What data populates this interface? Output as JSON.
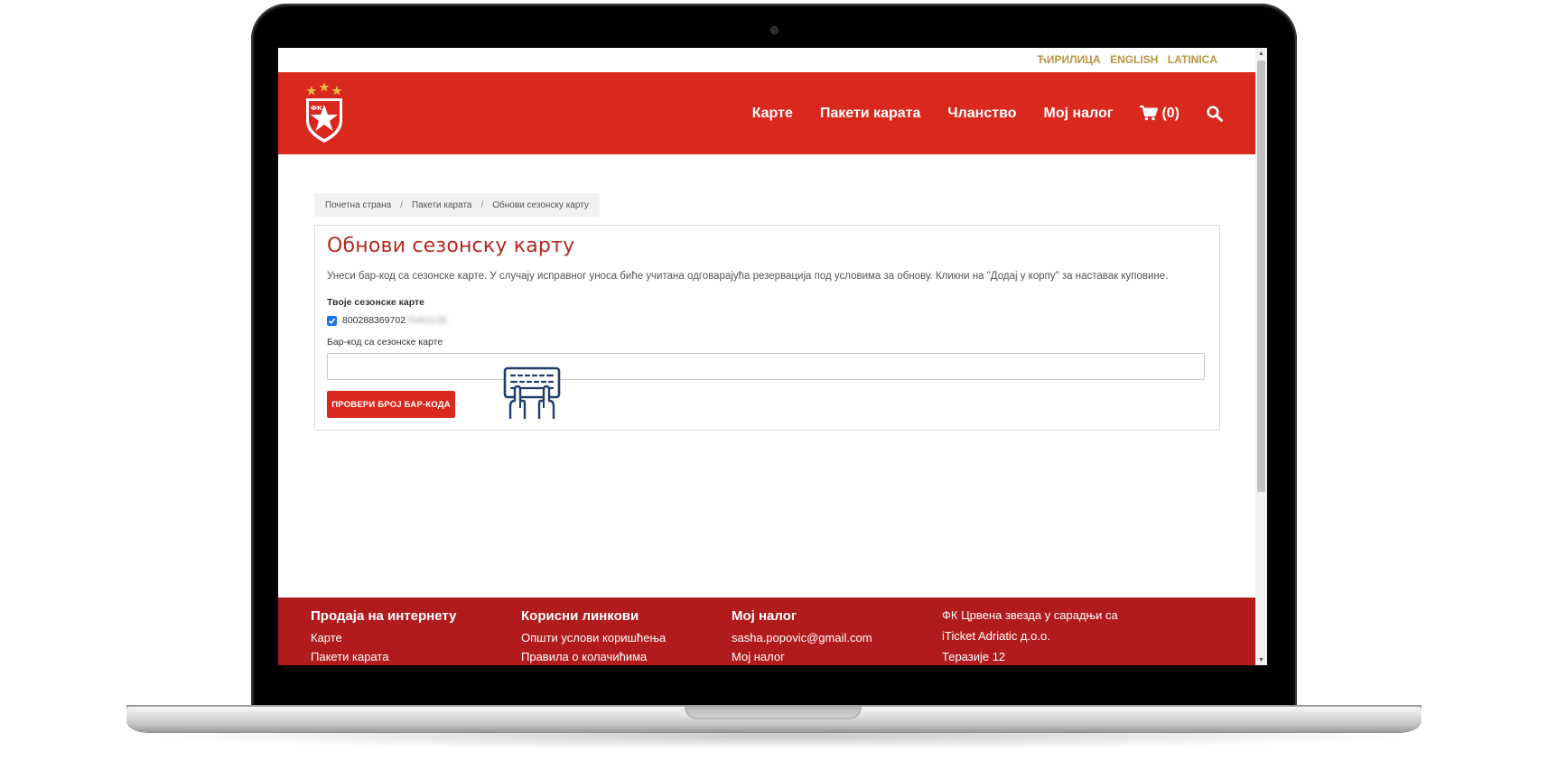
{
  "languages": [
    "ЋИРИЛИЦА",
    "ENGLISH",
    "LATINICA"
  ],
  "nav": {
    "items": [
      "Карте",
      "Пакети карата",
      "Чланство",
      "Мој налог"
    ],
    "cart_label": "(0)",
    "icons": {
      "cart": "shopping-cart-icon",
      "search": "search-icon",
      "logo": "crvena-zvezda-crest"
    }
  },
  "breadcrumb": [
    "Почетна страна",
    "Пакети карата",
    "Обнови сезонску карту"
  ],
  "card": {
    "title": "Обнови сезонску карту",
    "description": "Унеси бар-код са сезонске карте. У случају исправног уноса биће учитана одговарајућа резервација под условима за обнову. Кликни на \"Додај у корпу\" за наставак куповине.",
    "season_tickets_label": "Твоје сезонске карте",
    "ticket_visible": "800288369702",
    "ticket_blurred": "75401135",
    "barcode_label": "Бар-код са сезонске карте",
    "barcode_value": "",
    "button_label": "ПРОВЕРИ БРОЈ БАР-КОДА"
  },
  "footer": {
    "col1": {
      "heading": "Продаја на интернету",
      "links": [
        "Карте",
        "Пакети карата"
      ]
    },
    "col2": {
      "heading": "Корисни линкови",
      "links": [
        "Општи услови коришћења",
        "Правила о колачићима"
      ]
    },
    "col3": {
      "heading": "Мој налог",
      "links": [
        "sasha.popovic@gmail.com",
        "Мој налог"
      ]
    },
    "col4": {
      "lines": [
        "ФК Црвена звезда у сарадњи са",
        "iTicket Adriatic д.о.о.",
        "Теразије 12"
      ]
    }
  },
  "colors": {
    "brand_red": "#d9281d",
    "footer_red": "#b11b1b",
    "title_red": "#b3291f",
    "lang_gold": "#b89442"
  }
}
